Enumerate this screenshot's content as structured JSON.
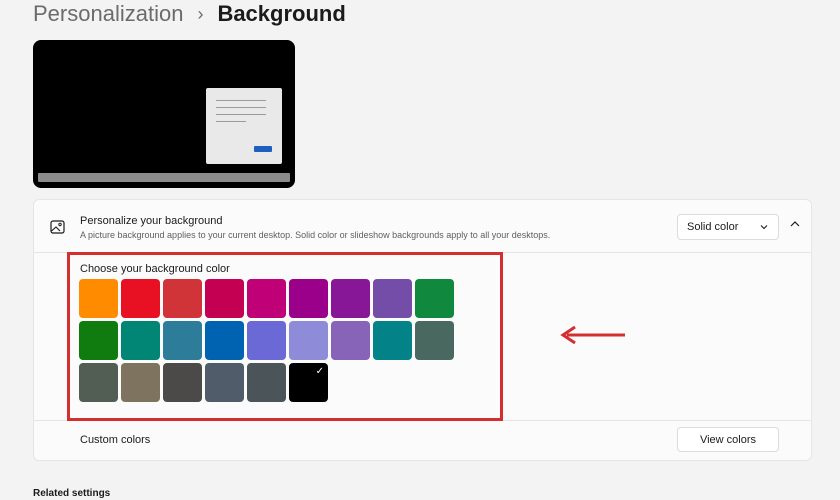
{
  "breadcrumb": {
    "parent": "Personalization",
    "separator": "›",
    "current": "Background"
  },
  "background_card": {
    "title": "Personalize your background",
    "description": "A picture background applies to your current desktop. Solid color or slideshow backgrounds apply to all your desktops.",
    "dropdown_value": "Solid color",
    "icon": "image-icon"
  },
  "color_picker": {
    "label": "Choose your background color",
    "selected_index": 23,
    "colors": [
      "#ff8c00",
      "#e81123",
      "#d13438",
      "#c30052",
      "#bf0077",
      "#9a0089",
      "#881798",
      "#744da9",
      "#10893e",
      "#107c10",
      "#018574",
      "#2d7d9a",
      "#0063b1",
      "#6b69d6",
      "#8e8cd8",
      "#8764b8",
      "#038387",
      "#486860",
      "#525e54",
      "#7e735f",
      "#4c4a48",
      "#515c6b",
      "#4a5459",
      "#000000"
    ],
    "highlight_color": "#d32f2f"
  },
  "custom_colors": {
    "label": "Custom colors",
    "button_label": "View colors"
  },
  "related_settings": "Related settings"
}
